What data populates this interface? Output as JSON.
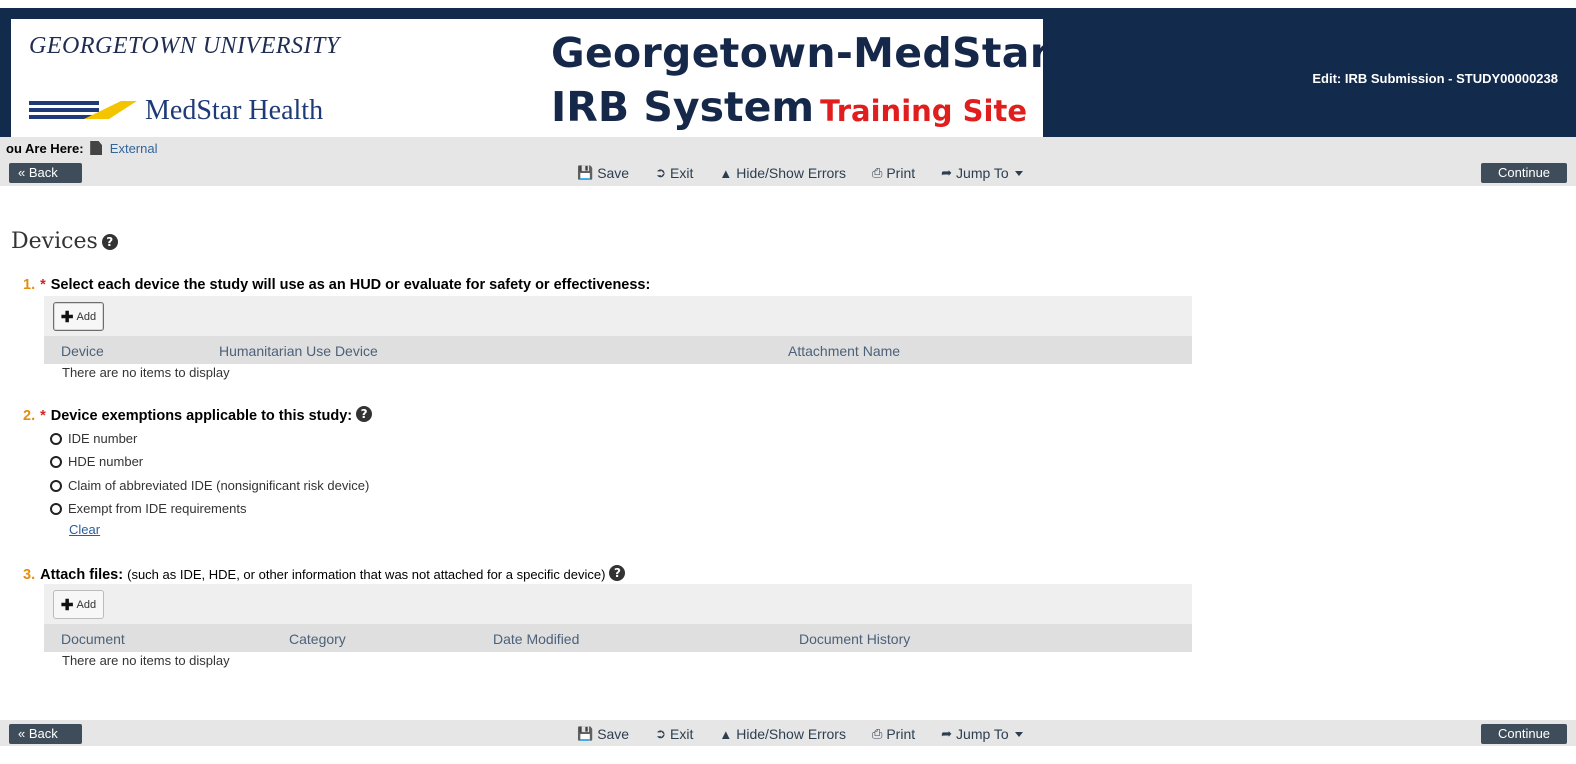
{
  "header": {
    "university": "GEORGETOWN UNIVERSITY",
    "medstar": "MedStar Health",
    "system_line1": "Georgetown-MedStar",
    "system_line2": "IRB System",
    "training": "Training Site",
    "edit_title": "Edit: IRB Submission - STUDY00000238",
    "colors": {
      "navy": "#122a4c",
      "red": "#e01e1e",
      "yellow": "#f5c400"
    }
  },
  "breadcrumb": {
    "label": "ou Are Here:",
    "link": "External"
  },
  "toolbar": {
    "back": "« Back",
    "save": "Save",
    "exit": "Exit",
    "errors": "Hide/Show Errors",
    "print": "Print",
    "jump": "Jump To",
    "continue": "Continue »"
  },
  "page": {
    "title": "Devices"
  },
  "q1": {
    "num": "1.",
    "req": "*",
    "text": "Select each device the study will use as an HUD or evaluate for safety or effectiveness:",
    "add": "Add",
    "columns": [
      "Device",
      "Humanitarian Use Device",
      "Attachment Name"
    ],
    "empty": "There are no items to display"
  },
  "q2": {
    "num": "2.",
    "req": "*",
    "text": "Device exemptions applicable to this study:",
    "options": [
      "IDE number",
      "HDE number",
      "Claim of abbreviated IDE (nonsignificant risk device)",
      "Exempt from IDE requirements"
    ],
    "clear": "Clear"
  },
  "q3": {
    "num": "3.",
    "text": "Attach files:",
    "sub": "(such as IDE, HDE, or other information that was not attached for a specific device)",
    "add": "Add",
    "columns": [
      "Document",
      "Category",
      "Date Modified",
      "Document History"
    ],
    "empty": "There are no items to display"
  }
}
